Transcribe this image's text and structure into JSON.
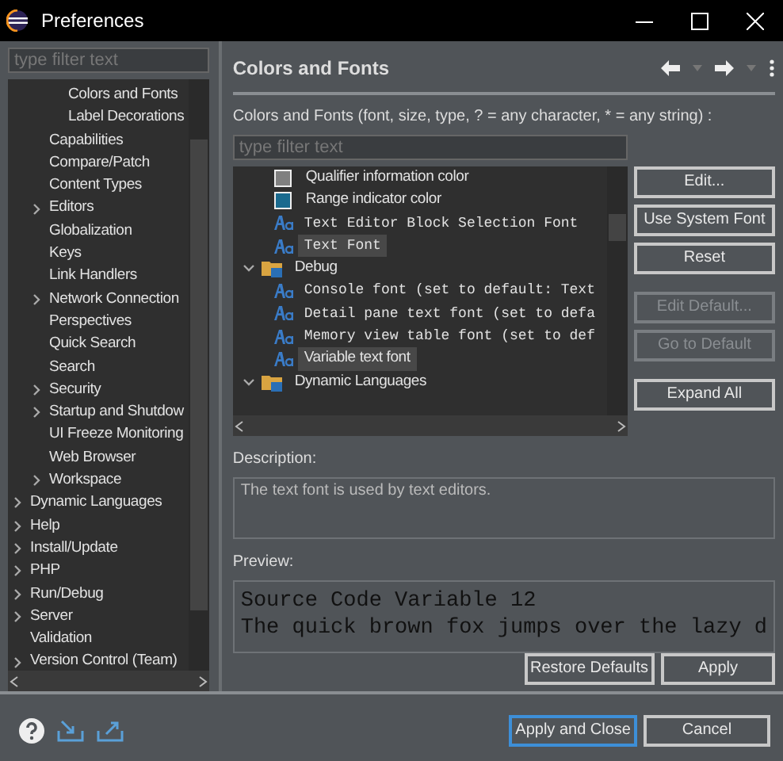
{
  "window": {
    "title": "Preferences"
  },
  "filter": {
    "placeholder": "type filter text"
  },
  "nav_tree": [
    {
      "children": [
        {
          "children": [
            {
              "label": "Colors and Fonts",
              "expandable": false
            },
            {
              "label": "Label Decorations",
              "expandable": false
            }
          ]
        },
        {
          "label": "Capabilities",
          "expandable": false
        },
        {
          "label": "Compare/Patch",
          "expandable": false
        },
        {
          "label": "Content Types",
          "expandable": false
        },
        {
          "label": "Editors",
          "expandable": true
        },
        {
          "label": "Globalization",
          "expandable": false
        },
        {
          "label": "Keys",
          "expandable": false
        },
        {
          "label": "Link Handlers",
          "expandable": false
        },
        {
          "label": "Network Connection",
          "expandable": true
        },
        {
          "label": "Perspectives",
          "expandable": false
        },
        {
          "label": "Quick Search",
          "expandable": false
        },
        {
          "label": "Search",
          "expandable": false
        },
        {
          "label": "Security",
          "expandable": true
        },
        {
          "label": "Startup and Shutdow",
          "expandable": true
        },
        {
          "label": "UI Freeze Monitoring",
          "expandable": false
        },
        {
          "label": "Web Browser",
          "expandable": false
        },
        {
          "label": "Workspace",
          "expandable": true
        }
      ]
    },
    {
      "label": "Dynamic Languages",
      "expandable": true
    },
    {
      "label": "Help",
      "expandable": true
    },
    {
      "label": "Install/Update",
      "expandable": true
    },
    {
      "label": "PHP",
      "expandable": true
    },
    {
      "label": "Run/Debug",
      "expandable": true
    },
    {
      "label": "Server",
      "expandable": true
    },
    {
      "label": "Validation",
      "expandable": false
    },
    {
      "label": "Version Control (Team)",
      "expandable": true
    }
  ],
  "page": {
    "title": "Colors and Fonts",
    "filter_label": "Colors and Fonts (font, size, type, ? = any character, * = any string) :",
    "filter_placeholder": "type filter text",
    "items": [
      {
        "kind": "color",
        "label": "Qualifier information color",
        "color": "#808080",
        "selected": false
      },
      {
        "kind": "color",
        "label": "Range indicator color",
        "color": "#1a6a8e",
        "selected": false
      },
      {
        "kind": "font",
        "label": "Text Editor Block Selection Font",
        "monospace": true,
        "selected": false
      },
      {
        "kind": "font",
        "label": "Text Font",
        "monospace": true,
        "selected": true
      },
      {
        "kind": "category",
        "label": "Debug",
        "expanded": true,
        "selected": false
      },
      {
        "kind": "font",
        "label": "Console font (set to default: Text",
        "monospace": true,
        "selected": false
      },
      {
        "kind": "font",
        "label": "Detail pane text font (set to defa",
        "monospace": true,
        "selected": false
      },
      {
        "kind": "font",
        "label": "Memory view table font (set to def",
        "monospace": true,
        "selected": false
      },
      {
        "kind": "font",
        "label": "Variable text font",
        "monospace": false,
        "selected": true
      },
      {
        "kind": "category",
        "label": "Dynamic Languages",
        "expanded": true,
        "selected": false
      }
    ],
    "side_button_groups": [
      [
        {
          "label": "Edit...",
          "disabled": false
        },
        {
          "label": "Use System Font",
          "disabled": false
        },
        {
          "label": "Reset",
          "disabled": false
        }
      ],
      [
        {
          "label": "Edit Default...",
          "disabled": true
        },
        {
          "label": "Go to Default",
          "disabled": true
        }
      ],
      [
        {
          "label": "Expand All",
          "disabled": false
        }
      ]
    ],
    "description_label": "Description:",
    "description": "The text font is used by text editors.",
    "preview_label": "Preview:",
    "preview": [
      "Source Code Variable 12",
      "The quick brown fox jumps over the lazy d"
    ],
    "page_buttons": [
      "Restore Defaults",
      "Apply"
    ]
  },
  "dialog_buttons": [
    {
      "label": "Apply and Close",
      "default": true
    },
    {
      "label": "Cancel",
      "default": false
    }
  ]
}
